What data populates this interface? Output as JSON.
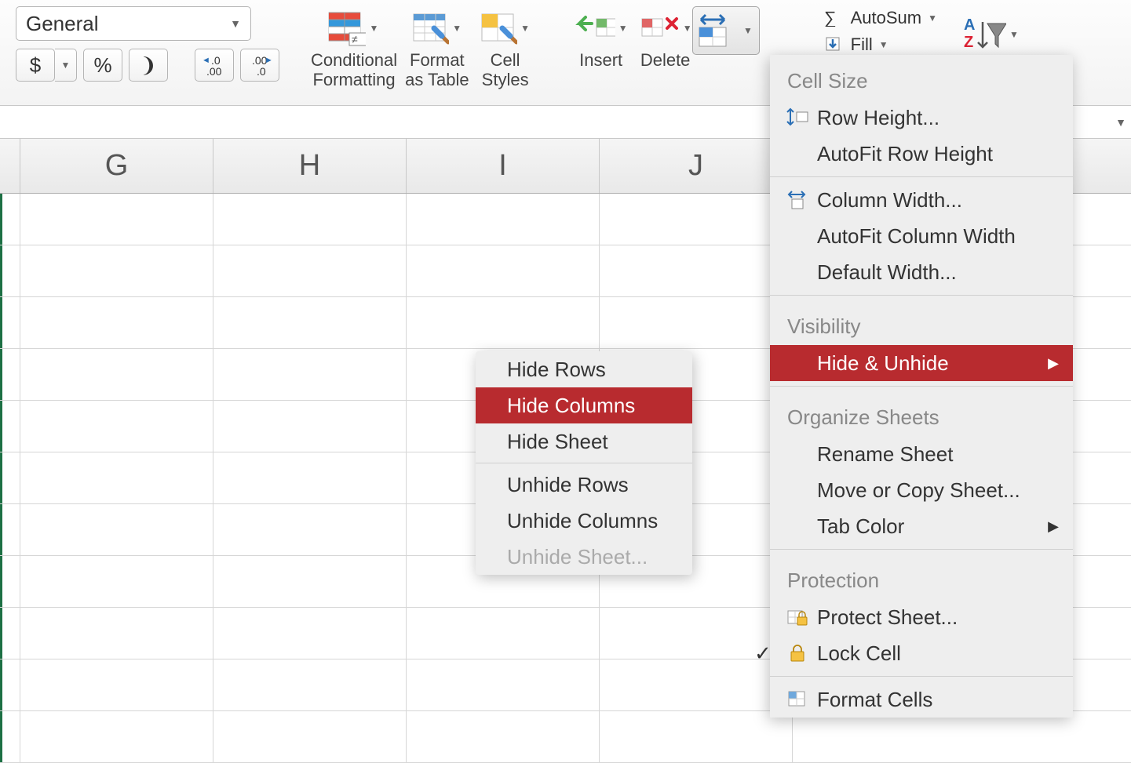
{
  "number_format": {
    "selector": "General",
    "currency": "$",
    "percent": "%",
    "comma": "❩",
    "inc_dec": ".0",
    "dec_dec": ".00"
  },
  "styles_group": {
    "conditional_formatting": "Conditional\nFormatting",
    "format_as_table": "Format\nas Table",
    "cell_styles": "Cell\nStyles"
  },
  "cells_group": {
    "insert": "Insert",
    "delete": "Delete"
  },
  "editing_group": {
    "autosum": "AutoSum",
    "fill": "Fill"
  },
  "columns": [
    "G",
    "H",
    "I",
    "J"
  ],
  "format_menu": {
    "cell_size_label": "Cell Size",
    "row_height": "Row Height...",
    "autofit_row_height": "AutoFit Row Height",
    "column_width": "Column Width...",
    "autofit_column_width": "AutoFit Column Width",
    "default_width": "Default Width...",
    "visibility_label": "Visibility",
    "hide_unhide": "Hide & Unhide",
    "organize_label": "Organize Sheets",
    "rename_sheet": "Rename Sheet",
    "move_copy_sheet": "Move or Copy Sheet...",
    "tab_color": "Tab Color",
    "protection_label": "Protection",
    "protect_sheet": "Protect Sheet...",
    "lock_cell": "Lock Cell",
    "format_cells": "Format Cells"
  },
  "submenu": {
    "hide_rows": "Hide Rows",
    "hide_columns": "Hide Columns",
    "hide_sheet": "Hide Sheet",
    "unhide_rows": "Unhide Rows",
    "unhide_columns": "Unhide Columns",
    "unhide_sheet": "Unhide Sheet..."
  }
}
